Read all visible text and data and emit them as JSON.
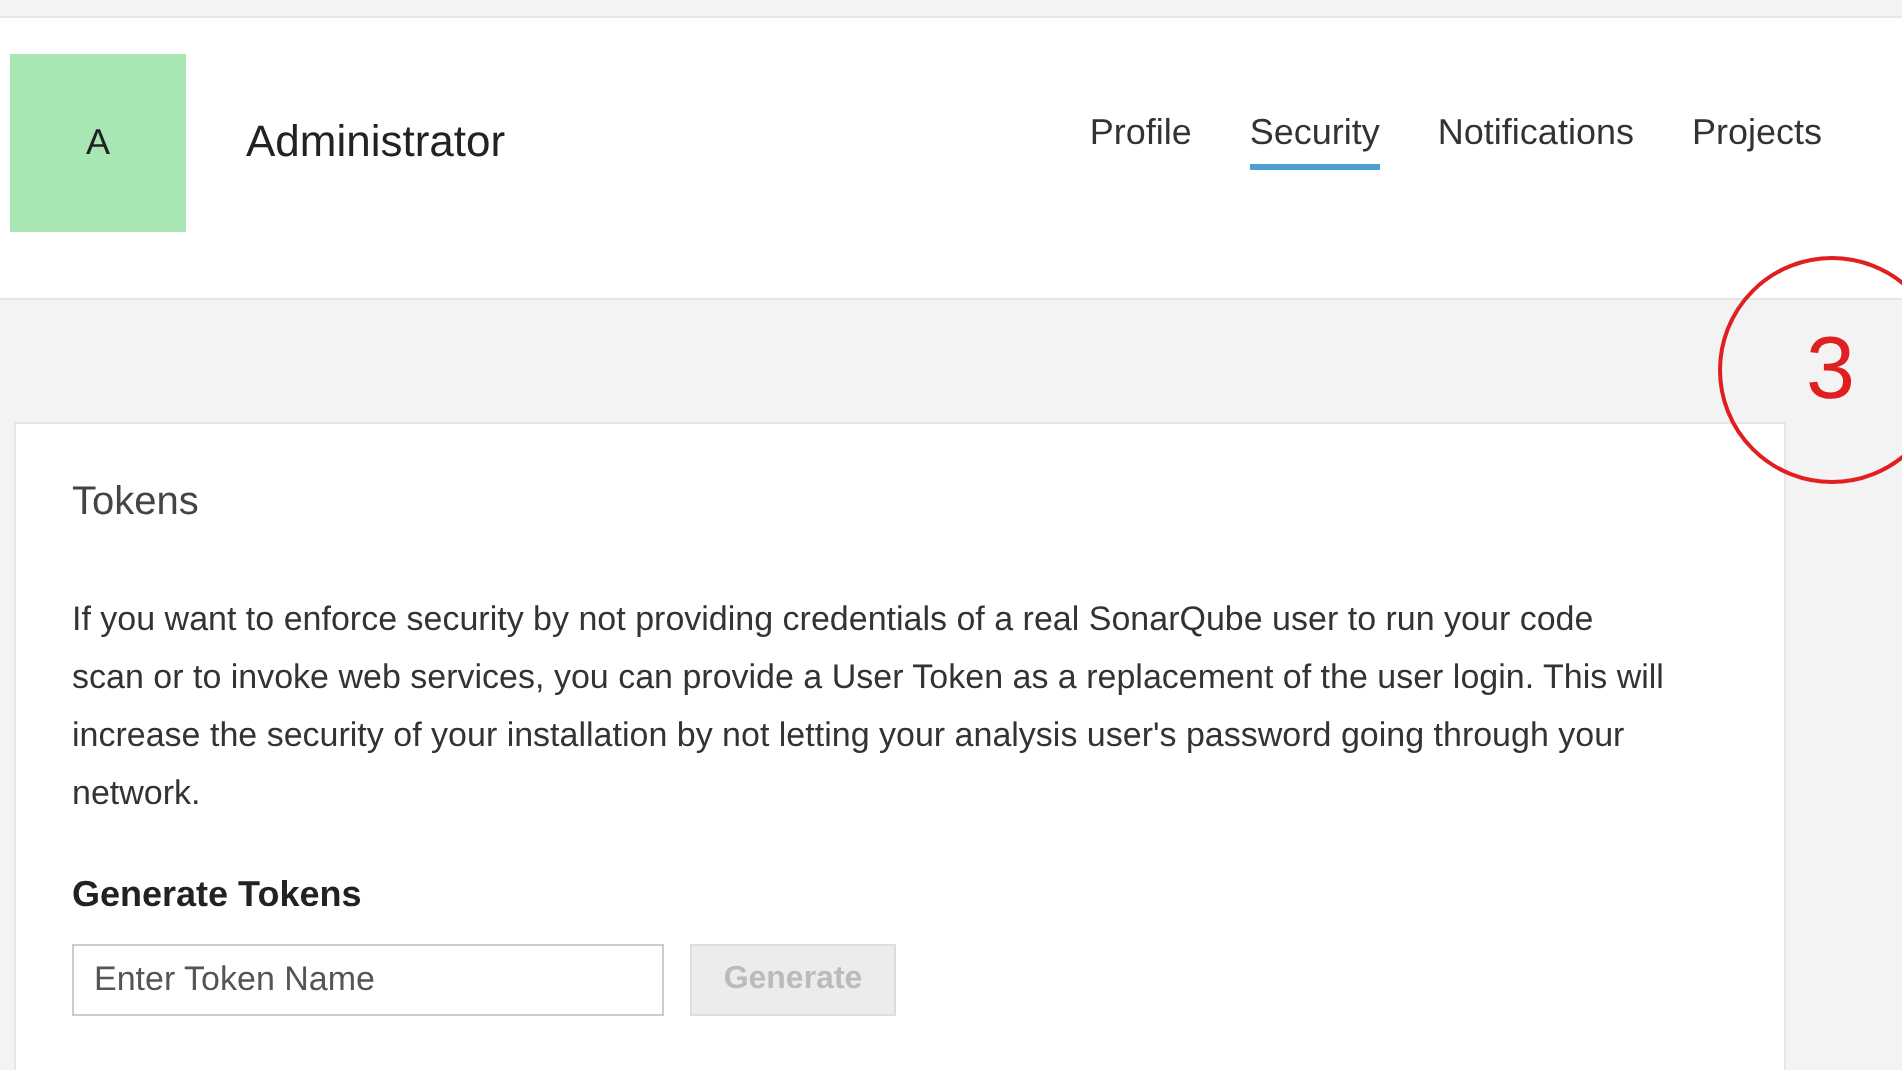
{
  "header": {
    "avatar": "A",
    "name": "Administrator"
  },
  "tabs": [
    {
      "label": "Profile",
      "selected": false
    },
    {
      "label": "Security",
      "selected": true
    },
    {
      "label": "Notifications",
      "selected": false
    },
    {
      "label": "Projects",
      "selected": false
    }
  ],
  "annotation": {
    "label": "3"
  },
  "card": {
    "title": "Tokens",
    "description": "If you want to enforce security by not providing credentials of a real SonarQube user to run your code scan or to invoke web services, you can provide a User Token as a replacement of the user login. This will increase the security of your installation by not letting your analysis user's password going through your network.",
    "section_title": "Generate Tokens",
    "token_field": {
      "placeholder": "Enter Token Name"
    },
    "generate_button": {
      "label": "Generate",
      "disabled": true
    }
  }
}
